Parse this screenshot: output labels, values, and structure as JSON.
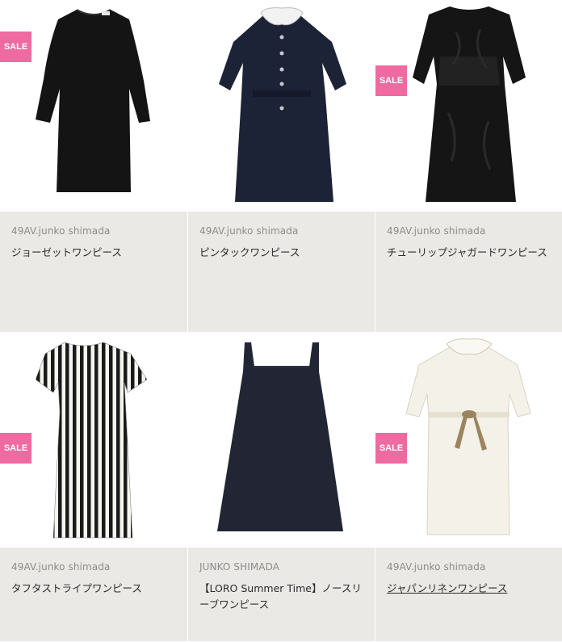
{
  "products": [
    {
      "brand": "49AV.junko shimada",
      "name": "ジョーゼットワンピース",
      "sale": true,
      "badge": "SALE"
    },
    {
      "brand": "49AV.junko shimada",
      "name": "ピンタックワンピース",
      "sale": false
    },
    {
      "brand": "49AV.junko shimada",
      "name": "チューリップジャガードワンピース",
      "sale": true,
      "badge": "SALE"
    },
    {
      "brand": "49AV.junko shimada",
      "name": "タフタストライプワンピース",
      "sale": true,
      "badge": "SALE"
    },
    {
      "brand": "JUNKO SHIMADA",
      "name": "【LORO Summer Time】ノースリーブワンピース",
      "sale": false
    },
    {
      "brand": "49AV.junko shimada",
      "name": "ジャパンリネンワンピース",
      "sale": true,
      "badge": "SALE",
      "underlined": true
    }
  ],
  "colors": {
    "sale_badge": "#ef6aa0",
    "info_bg": "#ebe9e6",
    "brand_text": "#8c8c8c"
  }
}
